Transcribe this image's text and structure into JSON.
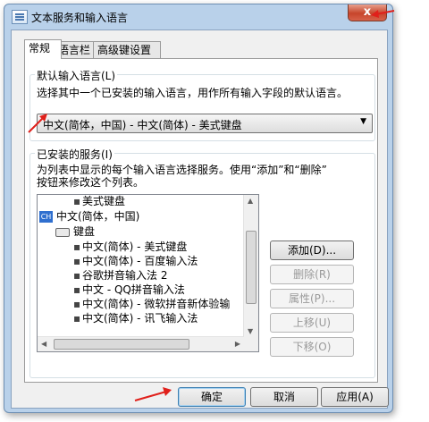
{
  "window": {
    "title": "文本服务和输入语言",
    "close_label": "x"
  },
  "tabs": [
    {
      "label": "常规"
    },
    {
      "label": "语言栏"
    },
    {
      "label": "高级键设置"
    }
  ],
  "default_lang": {
    "legend": "默认输入语言(L)",
    "description": "选择其中一个已安装的输入语言，用作所有输入字段的默认语言。",
    "selected": "中文(简体，中国) - 中文(简体) - 美式键盘"
  },
  "services": {
    "legend": "已安装的服务(I)",
    "description_line1": "为列表中显示的每个输入语言选择服务。使用“添加”和“删除”",
    "description_line2": "按钮来修改这个列表。",
    "tree": {
      "top_item": "美式键盘",
      "lang_badge": "CH",
      "lang_label": "中文(简体，中国)",
      "keyboard_label": "键盘",
      "items": [
        "中文(简体) - 美式键盘",
        "中文(简体) - 百度输入法",
        "谷歌拼音输入法 2",
        "中文 - QQ拼音输入法",
        "中文(简体) - 微软拼音新体验输",
        "中文(简体) - 讯飞输入法"
      ]
    },
    "buttons": {
      "add": "添加(D)...",
      "remove": "删除(R)",
      "properties": "属性(P)...",
      "move_up": "上移(U)",
      "move_down": "下移(O)"
    }
  },
  "footer": {
    "ok": "确定",
    "cancel": "取消",
    "apply": "应用(A)"
  },
  "colors": {
    "annotation_arrow": "#e0201b",
    "title_bar": "#b9d1ea",
    "lang_badge": "#2f6fcf"
  }
}
